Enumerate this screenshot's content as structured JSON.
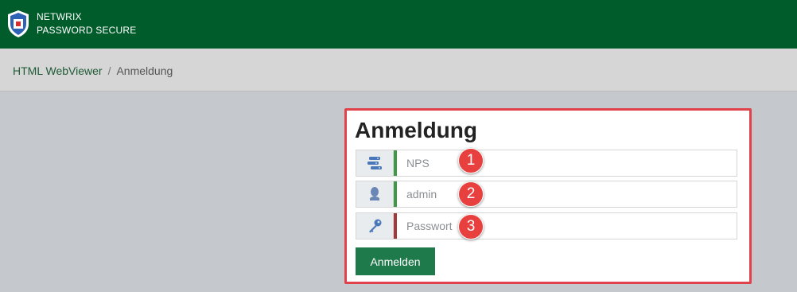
{
  "header": {
    "brand_line1": "NETWRIX",
    "brand_line2": "PASSWORD SECURE",
    "logo_icon": "netwrix-shield-icon",
    "bg_color": "#005c2b"
  },
  "breadcrumb": {
    "items": [
      "HTML WebViewer",
      "Anmeldung"
    ],
    "separator": "/"
  },
  "login": {
    "title": "Anmeldung",
    "fields": [
      {
        "icon": "database-icon",
        "value": "",
        "placeholder": "NPS",
        "status_color": "#3e9a46"
      },
      {
        "icon": "user-icon",
        "value": "",
        "placeholder": "admin",
        "status_color": "#3e9a46"
      },
      {
        "icon": "key-icon",
        "value": "",
        "placeholder": "Passwort",
        "status_color": "#a23a3a"
      }
    ],
    "submit_label": "Anmelden"
  },
  "annotations": {
    "badges": [
      "1",
      "2",
      "3"
    ],
    "highlight_color": "#e0424b"
  }
}
